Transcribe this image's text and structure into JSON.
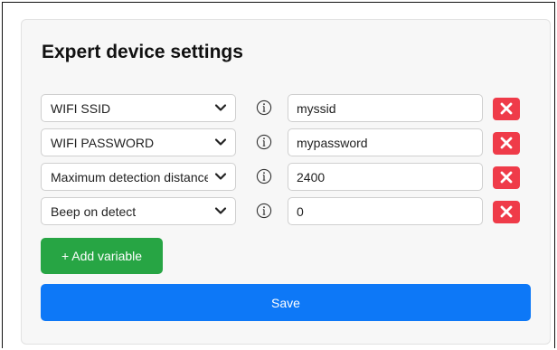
{
  "card": {
    "title": "Expert device settings"
  },
  "variables": [
    {
      "name": "WIFI SSID",
      "value": "myssid"
    },
    {
      "name": "WIFI PASSWORD",
      "value": "mypassword"
    },
    {
      "name": "Maximum detection distance",
      "value": "2400"
    },
    {
      "name": "Beep on detect",
      "value": "0"
    }
  ],
  "actions": {
    "add_label": "+ Add variable",
    "save_label": "Save"
  },
  "colors": {
    "delete": "#ef3b49",
    "add": "#27a544",
    "save": "#0d78f7"
  },
  "icons": {
    "dropdown": "chevron-down-icon",
    "info": "info-icon",
    "delete": "close-icon"
  }
}
